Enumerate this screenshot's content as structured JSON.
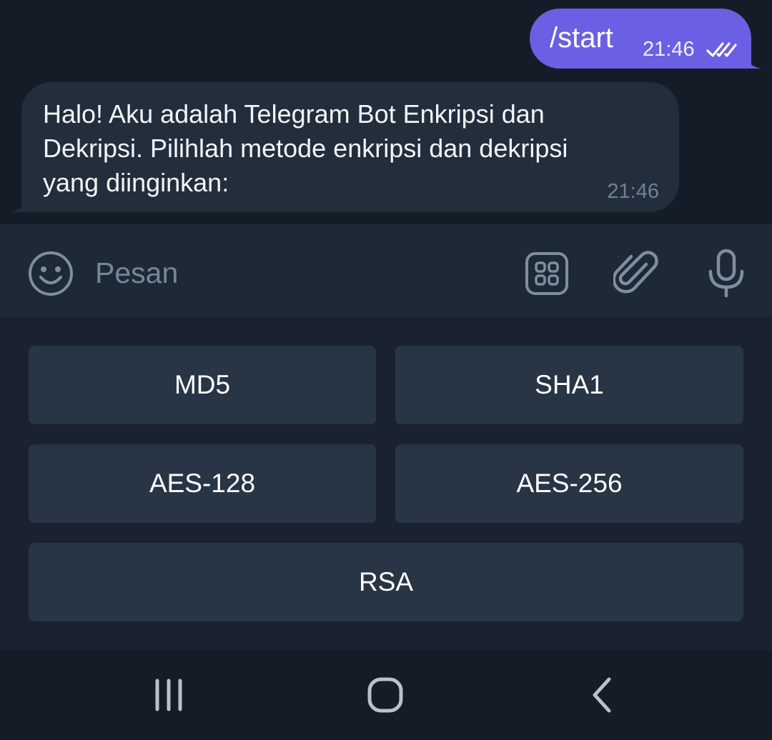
{
  "chat": {
    "outgoing": {
      "text": "/start",
      "time": "21:46",
      "status_icon": "double-check-icon"
    },
    "incoming": {
      "text": "Halo! Aku adalah Telegram Bot Enkripsi dan\nDekripsi. Pilihlah metode enkripsi dan dekripsi\nyang diinginkan:",
      "time": "21:46"
    }
  },
  "input_bar": {
    "placeholder": "Pesan",
    "icons": [
      "smile-icon",
      "bot-commands-icon",
      "paperclip-icon",
      "microphone-icon"
    ]
  },
  "keyboard": {
    "buttons": [
      "MD5",
      "SHA1",
      "AES-128",
      "AES-256",
      "RSA"
    ]
  },
  "navbar": {
    "icons": [
      "recent-apps-icon",
      "home-icon",
      "back-icon"
    ]
  },
  "colors": {
    "outgoing_bubble": "#6b5fe3",
    "incoming_bubble": "#232e3c",
    "keyboard_button": "#283545",
    "background": "#1a2230"
  }
}
